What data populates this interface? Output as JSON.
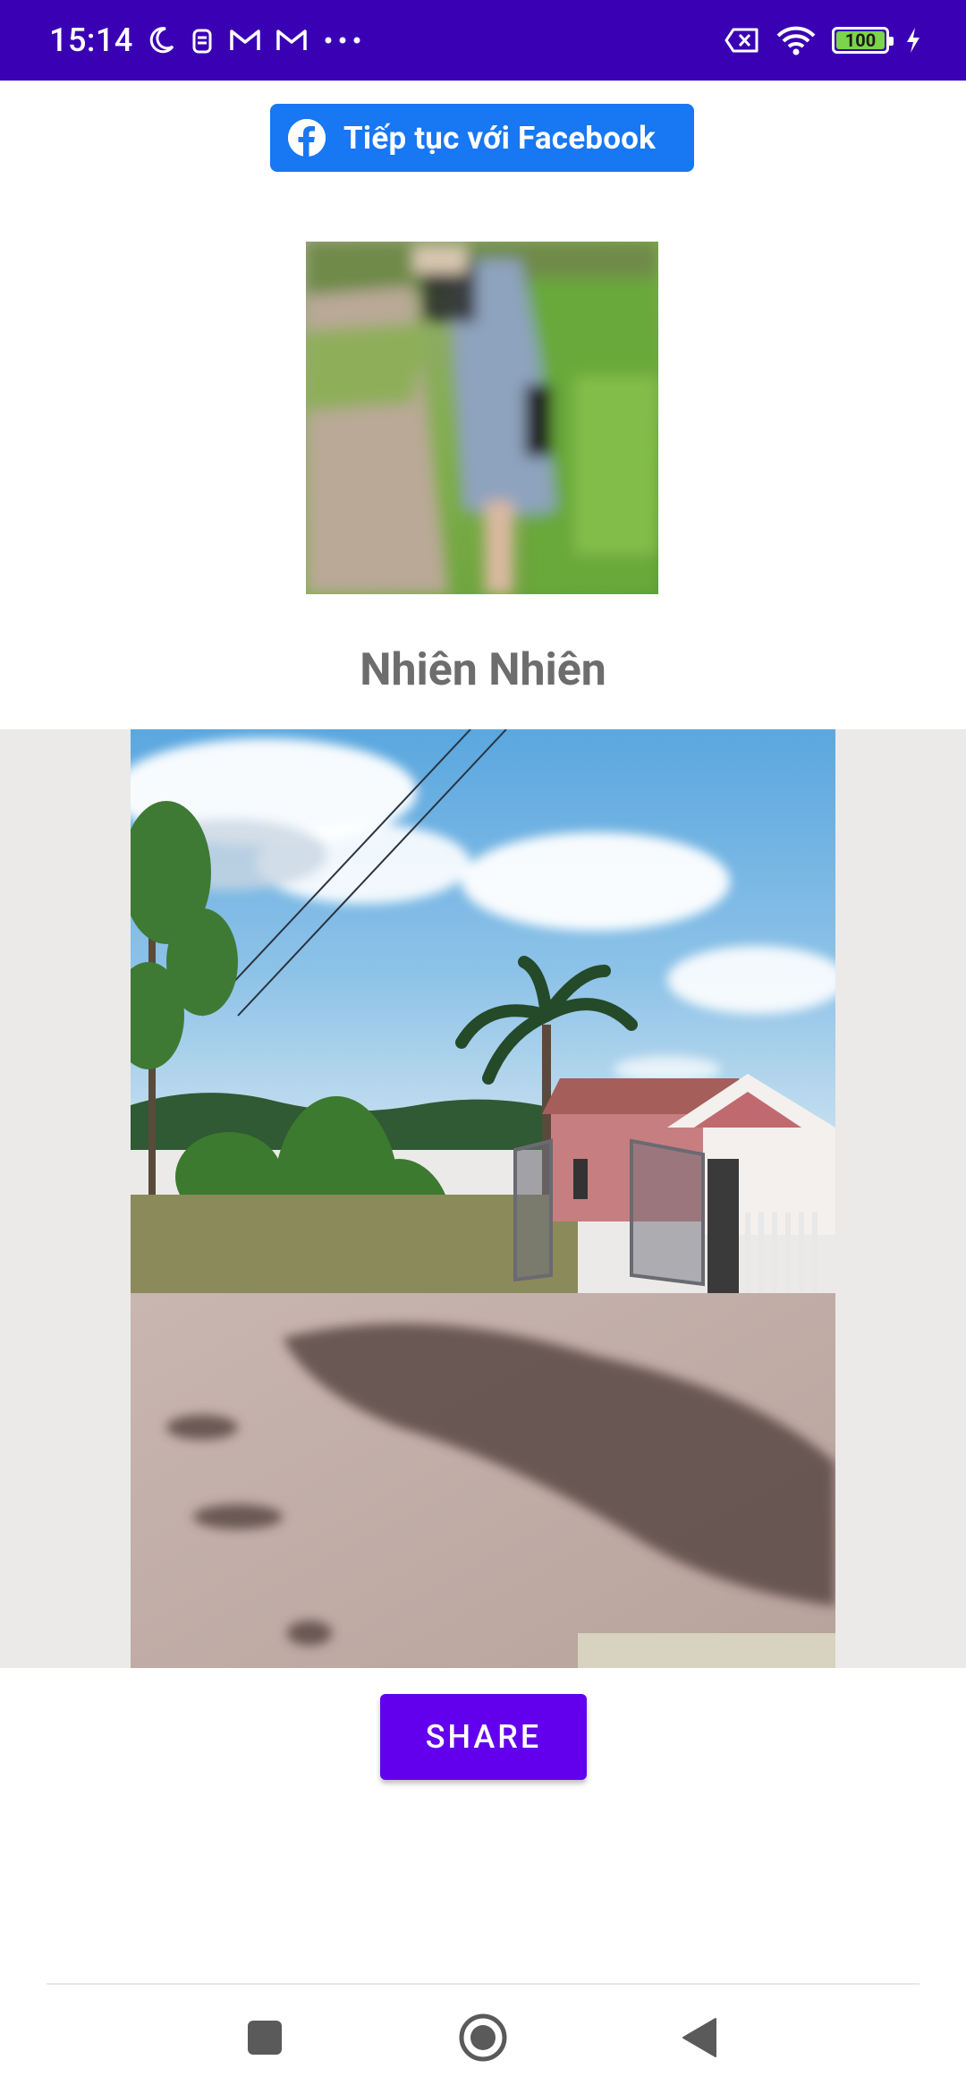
{
  "status_bar": {
    "time": "15:14",
    "battery_level": "100",
    "icons": [
      "moon-icon",
      "bag-icon",
      "gmail-icon",
      "gmail-icon",
      "more-dots-icon",
      "sim-off-icon",
      "wifi-icon",
      "battery-icon",
      "charging-icon"
    ],
    "background_color": "#3a00b4"
  },
  "facebook_button": {
    "label": "Tiếp tục với Facebook",
    "color": "#1877f2",
    "icon": "facebook-icon"
  },
  "profile": {
    "name": "Nhiên Nhiên"
  },
  "share_button": {
    "label": "SHARE",
    "color": "#6200ee"
  },
  "nav_bar": {
    "buttons": [
      "recents-square-icon",
      "home-circle-icon",
      "back-triangle-icon"
    ]
  }
}
